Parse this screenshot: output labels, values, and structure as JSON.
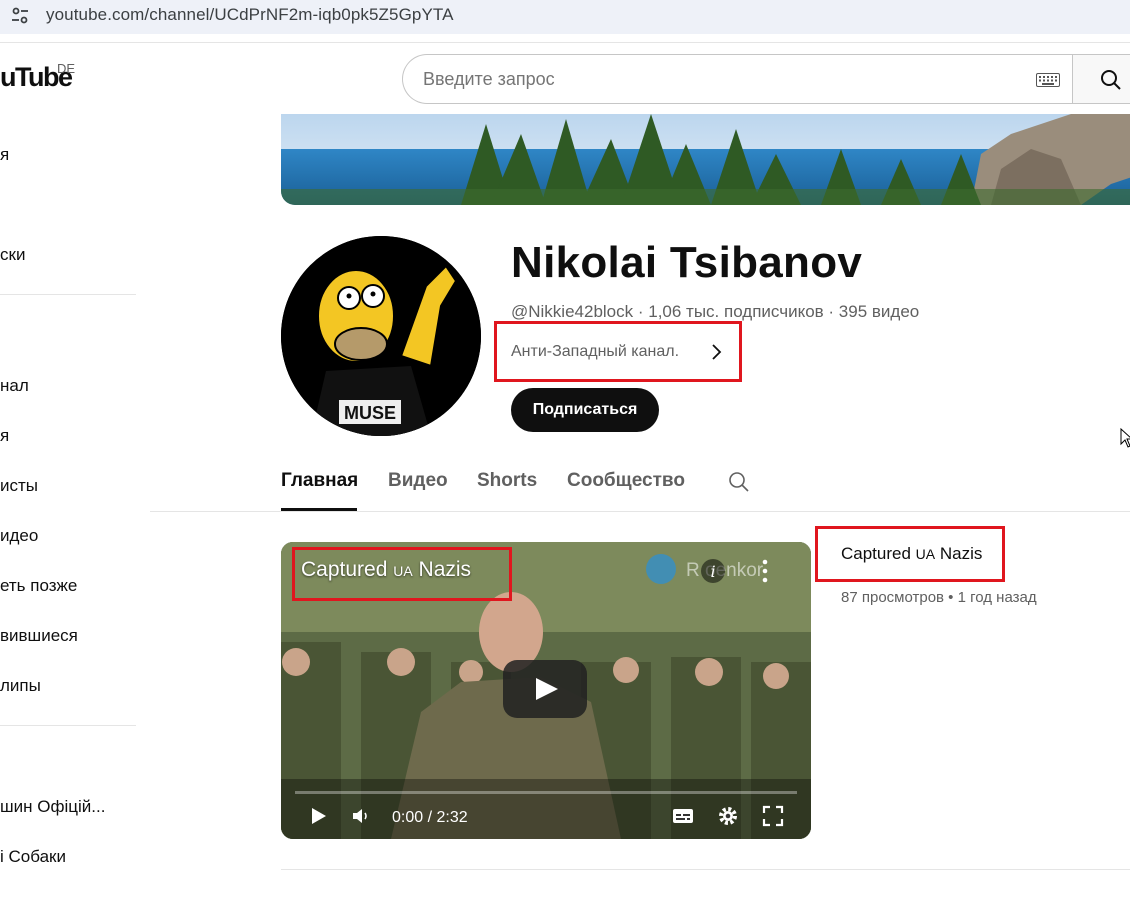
{
  "browser": {
    "url": "youtube.com/channel/UCdPrNF2m-iqb0pk5Z5GpYTA"
  },
  "header": {
    "logo": "uTube",
    "country": "DE",
    "search_placeholder": "Введите запрос"
  },
  "sidebar": {
    "items": [
      "я",
      "ски",
      "нал",
      "я",
      "исты",
      "идео",
      "еть позже",
      "вившиеся",
      "липы",
      "шин Офіцій...",
      "і Собаки"
    ]
  },
  "channel": {
    "name": "Nikolai Tsibanov",
    "handle_line": "@Nikkie42block · 1,06 тыс. подписчиков · 395 видео",
    "description": "Анти-Западный канал.",
    "subscribe_label": "Подписаться"
  },
  "tabs": [
    "Главная",
    "Видео",
    "Shorts",
    "Сообщество"
  ],
  "featured": {
    "title_pre": "Captured ",
    "title_flag": "UA",
    "title_post": " Nazis",
    "watermark": "R   oenkor",
    "time": "0:00 / 2:32",
    "views": "87 просмотров • 1 год назад"
  },
  "colors": {
    "highlight": "#e0161e",
    "accent": "#0f0f0f"
  }
}
